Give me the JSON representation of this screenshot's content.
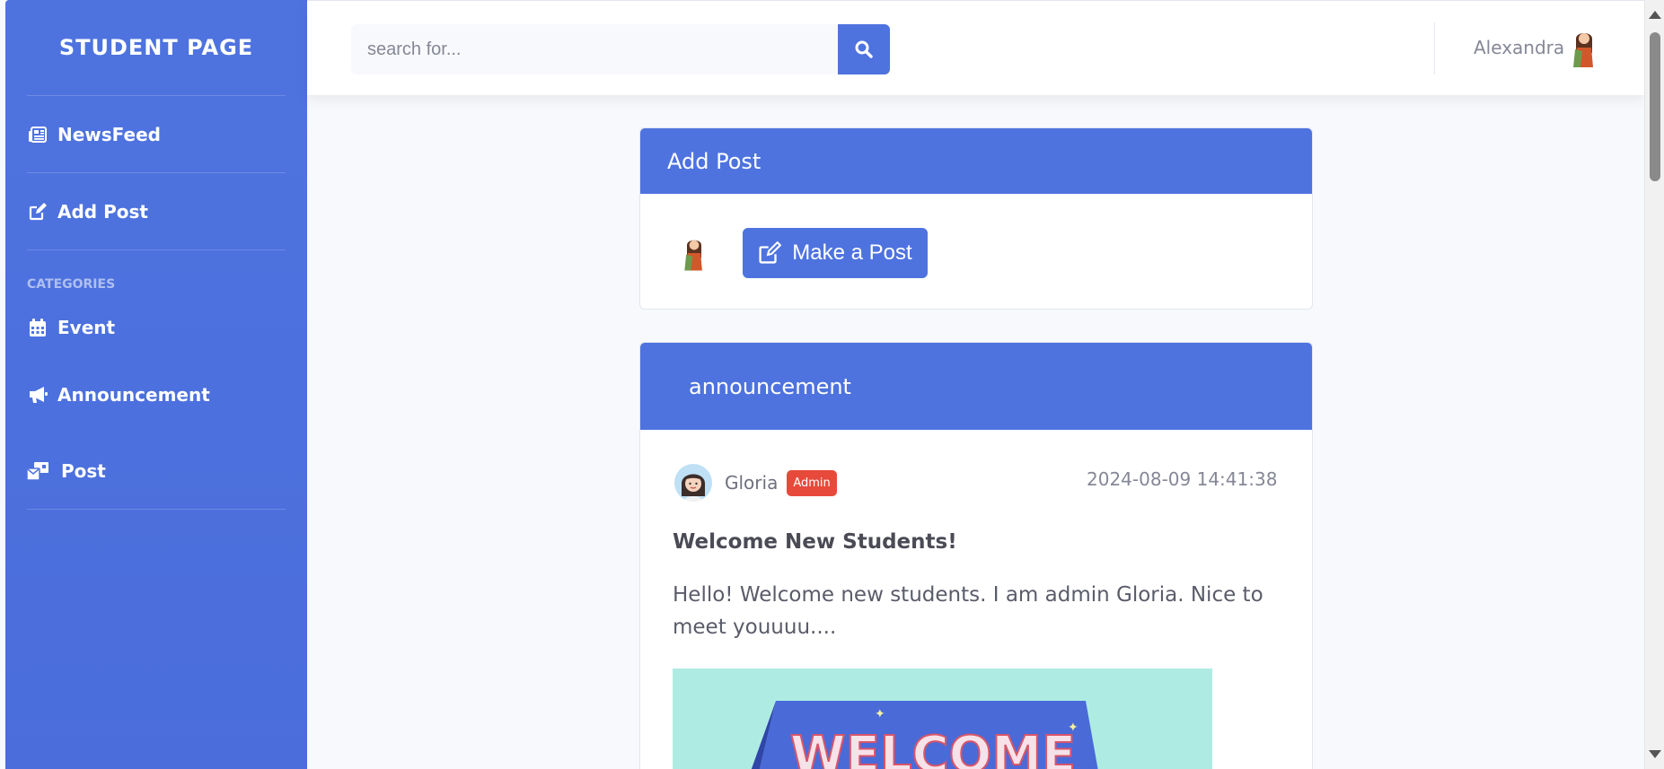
{
  "sidebar": {
    "brand": "STUDENT PAGE",
    "items": [
      {
        "label": "NewsFeed",
        "icon": "newspaper-icon"
      },
      {
        "label": "Add Post",
        "icon": "edit-icon"
      }
    ],
    "categories_heading": "CATEGORIES",
    "categories": [
      {
        "label": "Event",
        "icon": "calendar-icon"
      },
      {
        "label": "Announcement",
        "icon": "bullhorn-icon"
      },
      {
        "label": "Post",
        "icon": "mail-bulk-icon"
      }
    ]
  },
  "topbar": {
    "search_placeholder": "search for...",
    "user_name": "Alexandra"
  },
  "add_post_card": {
    "title": "Add Post",
    "button_label": "Make a Post"
  },
  "announcement_card": {
    "title": "announcement",
    "author": "Gloria",
    "badge": "Admin",
    "timestamp": "2024-08-09 14:41:38",
    "post_title": "Welcome New Students!",
    "post_text": "Hello! Welcome new students. I am admin Gloria. Nice to meet youuuu....",
    "image_text": "WELCOME"
  },
  "colors": {
    "primary": "#4e73df",
    "danger": "#e74a3b",
    "background": "#f8f9fc"
  }
}
